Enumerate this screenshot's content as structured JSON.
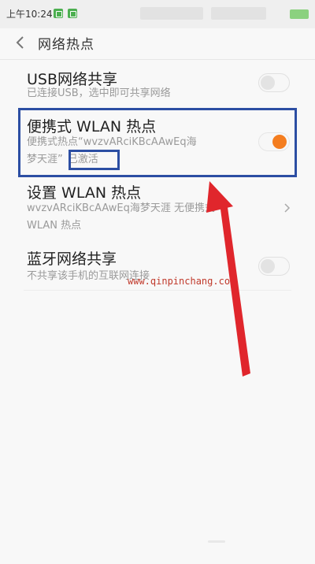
{
  "status_bar": {
    "time": "上午10:24"
  },
  "header": {
    "title": "网络热点"
  },
  "items": [
    {
      "title": "USB网络共享",
      "subtitle": "已连接USB，选中即可共享网络",
      "toggle": "off"
    },
    {
      "title": "便携式 WLAN 热点",
      "subtitle_line1": "便携式热点“wvzvARciKBcAAwEq海",
      "subtitle_line2_prefix": "梦天涯”",
      "subtitle_line2_status": "已激活",
      "toggle": "on"
    },
    {
      "title": "设置 WLAN 热点",
      "subtitle_line1": "wvzvARciKBcAAwEq海梦天涯 无便携式",
      "subtitle_line2": "WLAN 热点"
    },
    {
      "title": "蓝牙网络共享",
      "subtitle": "不共享该手机的互联网连接",
      "toggle": "off"
    }
  ],
  "watermark": "www.qinpinchang.com",
  "colors": {
    "accent": "#f47d1f",
    "highlight": "#2c4ea3",
    "arrow": "#e0262c"
  }
}
